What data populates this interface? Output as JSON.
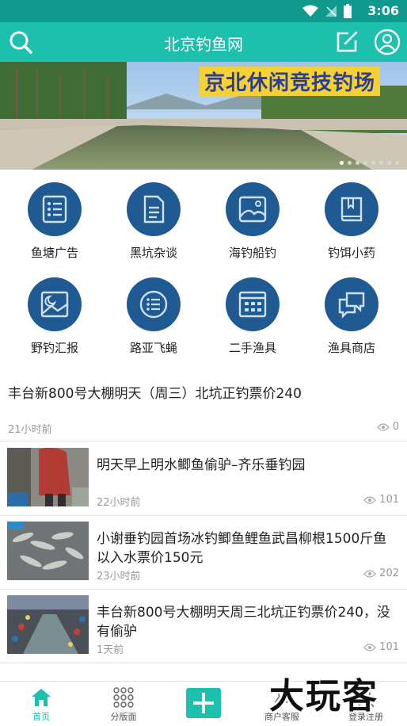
{
  "status": {
    "time": "3:06"
  },
  "header": {
    "title": "北京钓鱼网"
  },
  "banner": {
    "headline": "京北休闲竞技钓场",
    "dots_total": 8,
    "active_dot": 1
  },
  "categories": [
    {
      "label": "鱼塘广告",
      "icon": "list-icon"
    },
    {
      "label": "黑坑杂谈",
      "icon": "document-icon"
    },
    {
      "label": "海钓船钓",
      "icon": "image-icon"
    },
    {
      "label": "钓饵小药",
      "icon": "book-icon"
    },
    {
      "label": "野钓汇报",
      "icon": "picture-icon"
    },
    {
      "label": "路亚飞蝇",
      "icon": "list-bullets-icon"
    },
    {
      "label": "二手渔具",
      "icon": "calendar-grid-icon"
    },
    {
      "label": "渔具商店",
      "icon": "chat-icon"
    }
  ],
  "posts": [
    {
      "title": "丰台新800号大棚明天（周三）北坑正钓票价240",
      "time": "21小时前",
      "views": "0"
    },
    {
      "title": "明天早上明水鲫鱼偷驴–齐乐垂钓园",
      "time": "22小时前",
      "views": "101"
    },
    {
      "title": "小谢垂钓园首场冰钓鲫鱼鲤鱼武昌柳根1500斤鱼以入水票价150元",
      "time": "23小时前",
      "views": "202"
    },
    {
      "title": "丰台新800号大棚明天周三北坑正钓票价240，没有偷驴",
      "time": "1天前",
      "views": "101"
    }
  ],
  "tabs": [
    {
      "label": "首页",
      "icon": "home-icon"
    },
    {
      "label": "分版面",
      "icon": "dots-grid-icon"
    },
    {
      "label": "",
      "icon": "plus-icon"
    },
    {
      "label": "商户客服",
      "icon": "service-icon"
    },
    {
      "label": "登录注册",
      "icon": "login-icon"
    }
  ],
  "watermark": "大玩客",
  "colors": {
    "accent": "#1dbfad",
    "status_bar": "#0f9a8d",
    "category_circle": "#1f5a93"
  }
}
